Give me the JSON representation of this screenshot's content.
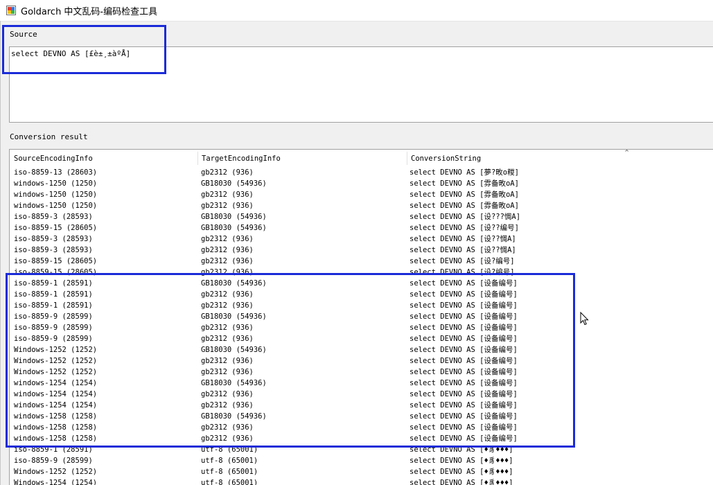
{
  "window": {
    "title": "Goldarch 中文乱码-编码检查工具"
  },
  "source": {
    "label": "Source",
    "value": "select DEVNO AS [£è±¸±àºÅ]"
  },
  "result": {
    "label": "Conversion result",
    "columns": [
      "SourceEncodingInfo",
      "TargetEncodingInfo",
      "ConversionString"
    ],
    "rows": [
      [
        "iso-8859-13 (28603)",
        "gb2312 (936)",
        "select DEVNO AS [夢?畋o糉]"
      ],
      [
        "windows-1250 (1250)",
        "GB18030 (54936)",
        "select DEVNO AS [雰备畋oA]"
      ],
      [
        "windows-1250 (1250)",
        "gb2312 (936)",
        "select DEVNO AS [雰备畋oA]"
      ],
      [
        "windows-1250 (1250)",
        "gb2312 (936)",
        "select DEVNO AS [雰备畋oA]"
      ],
      [
        "iso-8859-3 (28593)",
        "GB18030 (54936)",
        "select DEVNO AS [设???惆A]"
      ],
      [
        "iso-8859-15 (28605)",
        "GB18030 (54936)",
        "select DEVNO AS [设??编号]"
      ],
      [
        "iso-8859-3 (28593)",
        "gb2312 (936)",
        "select DEVNO AS [设??惆A]"
      ],
      [
        "iso-8859-3 (28593)",
        "gb2312 (936)",
        "select DEVNO AS [设??惆A]"
      ],
      [
        "iso-8859-15 (28605)",
        "gb2312 (936)",
        "select DEVNO AS [设?编号]"
      ],
      [
        "iso-8859-15 (28605)",
        "gb2312 (936)",
        "select DEVNO AS [设?编号]"
      ],
      [
        "iso-8859-1 (28591)",
        "GB18030 (54936)",
        "select DEVNO AS [设备编号]"
      ],
      [
        "iso-8859-1 (28591)",
        "gb2312 (936)",
        "select DEVNO AS [设备编号]"
      ],
      [
        "iso-8859-1 (28591)",
        "gb2312 (936)",
        "select DEVNO AS [设备编号]"
      ],
      [
        "iso-8859-9 (28599)",
        "GB18030 (54936)",
        "select DEVNO AS [设备编号]"
      ],
      [
        "iso-8859-9 (28599)",
        "gb2312 (936)",
        "select DEVNO AS [设备编号]"
      ],
      [
        "iso-8859-9 (28599)",
        "gb2312 (936)",
        "select DEVNO AS [设备编号]"
      ],
      [
        "Windows-1252 (1252)",
        "GB18030 (54936)",
        "select DEVNO AS [设备编号]"
      ],
      [
        "Windows-1252 (1252)",
        "gb2312 (936)",
        "select DEVNO AS [设备编号]"
      ],
      [
        "Windows-1252 (1252)",
        "gb2312 (936)",
        "select DEVNO AS [设备编号]"
      ],
      [
        "windows-1254 (1254)",
        "GB18030 (54936)",
        "select DEVNO AS [设备编号]"
      ],
      [
        "windows-1254 (1254)",
        "gb2312 (936)",
        "select DEVNO AS [设备编号]"
      ],
      [
        "windows-1254 (1254)",
        "gb2312 (936)",
        "select DEVNO AS [设备编号]"
      ],
      [
        "windows-1258 (1258)",
        "GB18030 (54936)",
        "select DEVNO AS [设备编号]"
      ],
      [
        "windows-1258 (1258)",
        "gb2312 (936)",
        "select DEVNO AS [设备编号]"
      ],
      [
        "windows-1258 (1258)",
        "gb2312 (936)",
        "select DEVNO AS [设备编号]"
      ],
      [
        "iso-8859-1 (28591)",
        "utf-8 (65001)",
        "select DEVNO AS [♦豸♦♦♦]"
      ],
      [
        "iso-8859-9 (28599)",
        "utf-8 (65001)",
        "select DEVNO AS [♦豸♦♦♦]"
      ],
      [
        "Windows-1252 (1252)",
        "utf-8 (65001)",
        "select DEVNO AS [♦豸♦♦♦]"
      ],
      [
        "Windows-1254 (1254)",
        "utf-8 (65001)",
        "select DEVNO AS [♦豸♦♦♦]"
      ]
    ]
  },
  "colors": {
    "highlight": "#1a2bd8",
    "background": "#f0f0f0",
    "panel": "#ffffff"
  },
  "icons": {
    "app": "app-window-icon",
    "cursor": "mouse-pointer-icon",
    "sort": "sort-ascending-caret-icon"
  }
}
